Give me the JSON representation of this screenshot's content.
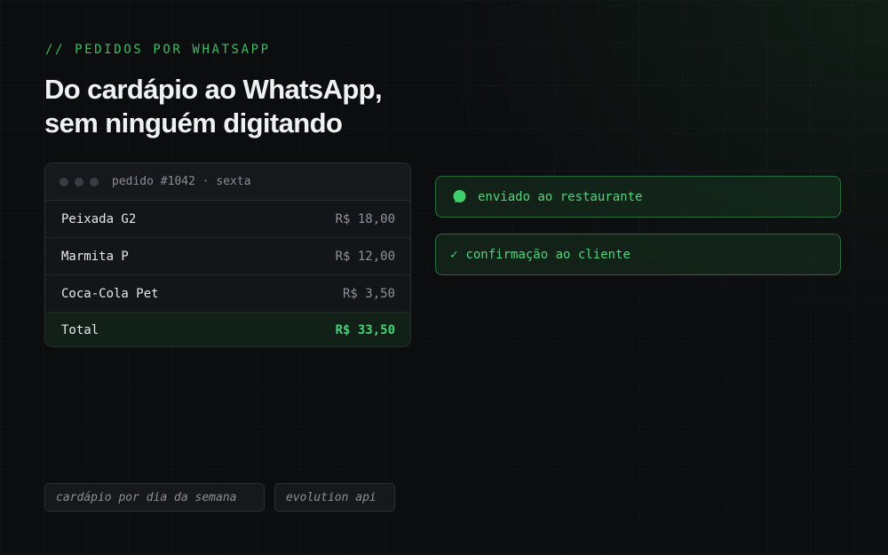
{
  "header": {
    "eyebrow": "// PEDIDOS POR WHATSAPP",
    "title_line1": "Do cardápio ao WhatsApp,",
    "title_line2": "sem ninguém digitando"
  },
  "order": {
    "header_label": "pedido #1042 · sexta",
    "items": [
      {
        "name": "Peixada G2",
        "price": "R$ 18,00"
      },
      {
        "name": "Marmita P",
        "price": "R$ 12,00"
      },
      {
        "name": "Coca-Cola Pet",
        "price": "R$ 3,50"
      }
    ],
    "total_label": "Total",
    "total_value": "R$ 33,50"
  },
  "status": {
    "sent_label": "enviado ao restaurante",
    "sent_icon": "chat-bubble-icon",
    "confirm_check": "✓",
    "confirm_label": "confirmação ao cliente"
  },
  "tags": [
    "cardápio por dia da semana",
    "evolution api"
  ],
  "colors": {
    "accent_green": "#52d37c",
    "background": "#0c0d0f",
    "card": "#141518"
  }
}
